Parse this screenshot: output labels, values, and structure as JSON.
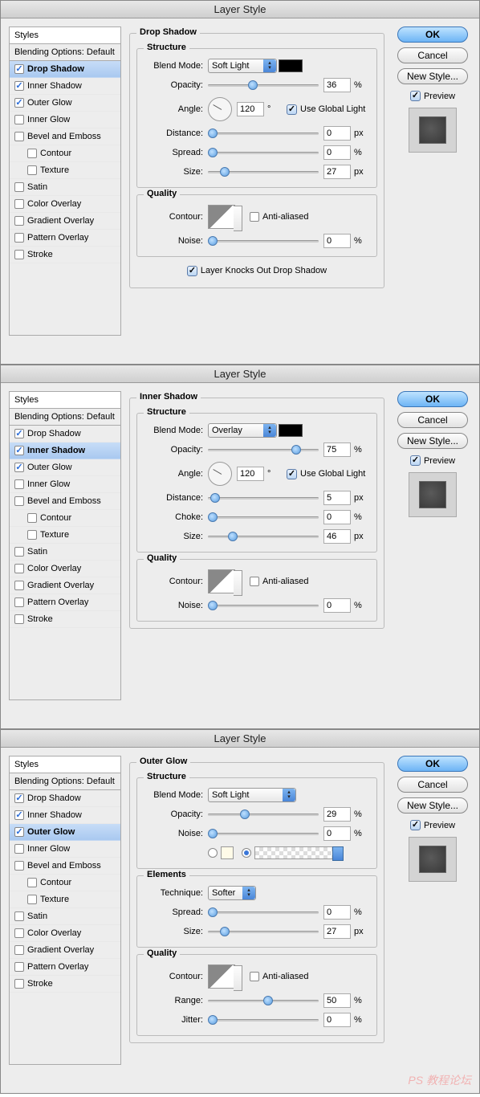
{
  "common": {
    "title": "Layer Style",
    "styles_header": "Styles",
    "blending": "Blending Options: Default",
    "styles": [
      "Drop Shadow",
      "Inner Shadow",
      "Outer Glow",
      "Inner Glow",
      "Bevel and Emboss",
      "Contour",
      "Texture",
      "Satin",
      "Color Overlay",
      "Gradient Overlay",
      "Pattern Overlay",
      "Stroke"
    ],
    "labels": {
      "blend_mode": "Blend Mode:",
      "opacity": "Opacity:",
      "angle": "Angle:",
      "use_global": "Use Global Light",
      "distance": "Distance:",
      "spread": "Spread:",
      "choke": "Choke:",
      "size": "Size:",
      "noise": "Noise:",
      "contour": "Contour:",
      "anti_aliased": "Anti-aliased",
      "technique": "Technique:",
      "range": "Range:",
      "jitter": "Jitter:",
      "knocks_out": "Layer Knocks Out Drop Shadow"
    },
    "sections": {
      "structure": "Structure",
      "quality": "Quality",
      "elements": "Elements"
    },
    "buttons": {
      "ok": "OK",
      "cancel": "Cancel",
      "new_style": "New Style...",
      "preview": "Preview"
    },
    "units": {
      "px": "px",
      "pct": "%",
      "deg": "°"
    }
  },
  "panels": [
    {
      "effect": "Drop Shadow",
      "checked": [
        0,
        1,
        2
      ],
      "selected": 0,
      "blend_mode": "Soft Light",
      "swatch": "#000000",
      "opacity": 36,
      "angle": 120,
      "use_global": true,
      "distance": 0,
      "spread": 0,
      "size": 27,
      "anti_aliased": false,
      "noise": 0,
      "knocks_out": true
    },
    {
      "effect": "Inner Shadow",
      "checked": [
        0,
        1,
        2
      ],
      "selected": 1,
      "blend_mode": "Overlay",
      "swatch": "#000000",
      "opacity": 75,
      "angle": 120,
      "use_global": true,
      "distance": 5,
      "choke": 0,
      "size": 46,
      "anti_aliased": false,
      "noise": 0
    },
    {
      "effect": "Outer Glow",
      "checked": [
        0,
        1,
        2
      ],
      "selected": 2,
      "blend_mode": "Soft Light",
      "opacity": 29,
      "noise": 0,
      "color_mode": "gradient",
      "technique": "Softer",
      "spread": 0,
      "size": 27,
      "anti_aliased": false,
      "range": 50,
      "jitter": 0
    }
  ],
  "watermark": "PS 教程论坛"
}
